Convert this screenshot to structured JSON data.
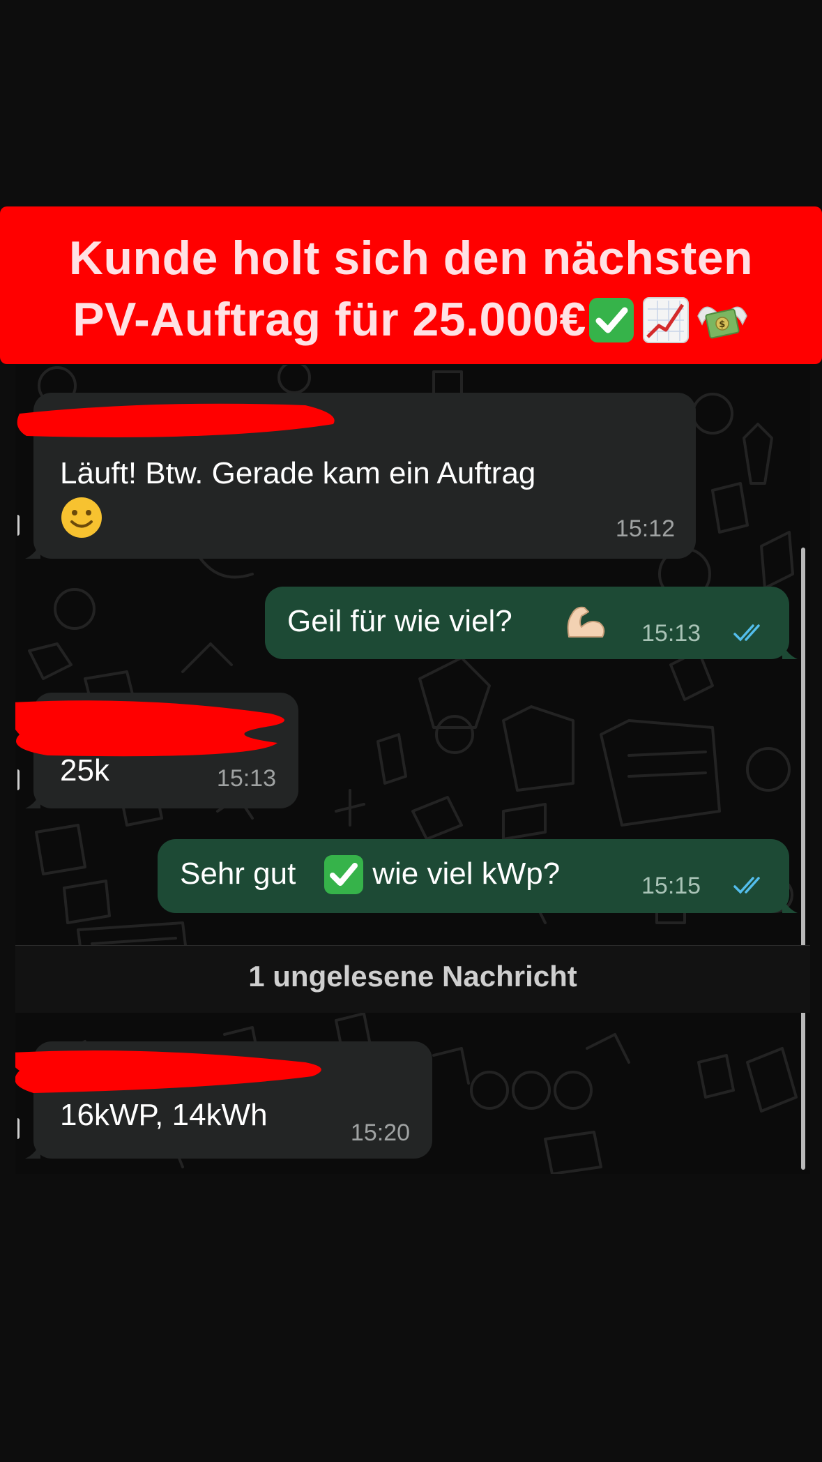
{
  "banner": {
    "line1": "Kunde holt sich den nächsten",
    "line2": "PV-Auftrag für 25.000€",
    "line2_emojis": [
      "check-mark-emoji",
      "chart-increasing-emoji",
      "money-with-wings-emoji"
    ]
  },
  "messages": [
    {
      "direction": "incoming",
      "text": "Läuft! Btw. Gerade kam ein Auftrag",
      "emoji": "slightly-smiling-face-emoji",
      "time": "15:12",
      "sender_redacted": true
    },
    {
      "direction": "outgoing",
      "text": "Geil für wie viel?",
      "emoji": "flexed-biceps-emoji",
      "time": "15:13",
      "status": "read"
    },
    {
      "direction": "incoming",
      "text": "25k",
      "time": "15:13",
      "sender_redacted": true
    },
    {
      "direction": "outgoing",
      "text_before": "Sehr gut",
      "emoji": "check-mark-emoji",
      "text_after": " wie viel kWp?",
      "time": "15:15",
      "status": "read"
    },
    {
      "direction": "incoming",
      "text": "16kWP, 14kWh",
      "time": "15:20",
      "sender_redacted": true
    }
  ],
  "unread_divider": "1 ungelesene Nachricht",
  "colors": {
    "banner": "#ff0000",
    "banner_text": "#ffe1e4",
    "incoming_bubble": "#232525",
    "outgoing_bubble": "#1d4a35",
    "read_ticks": "#53bdeb",
    "redaction": "#ff0000"
  }
}
